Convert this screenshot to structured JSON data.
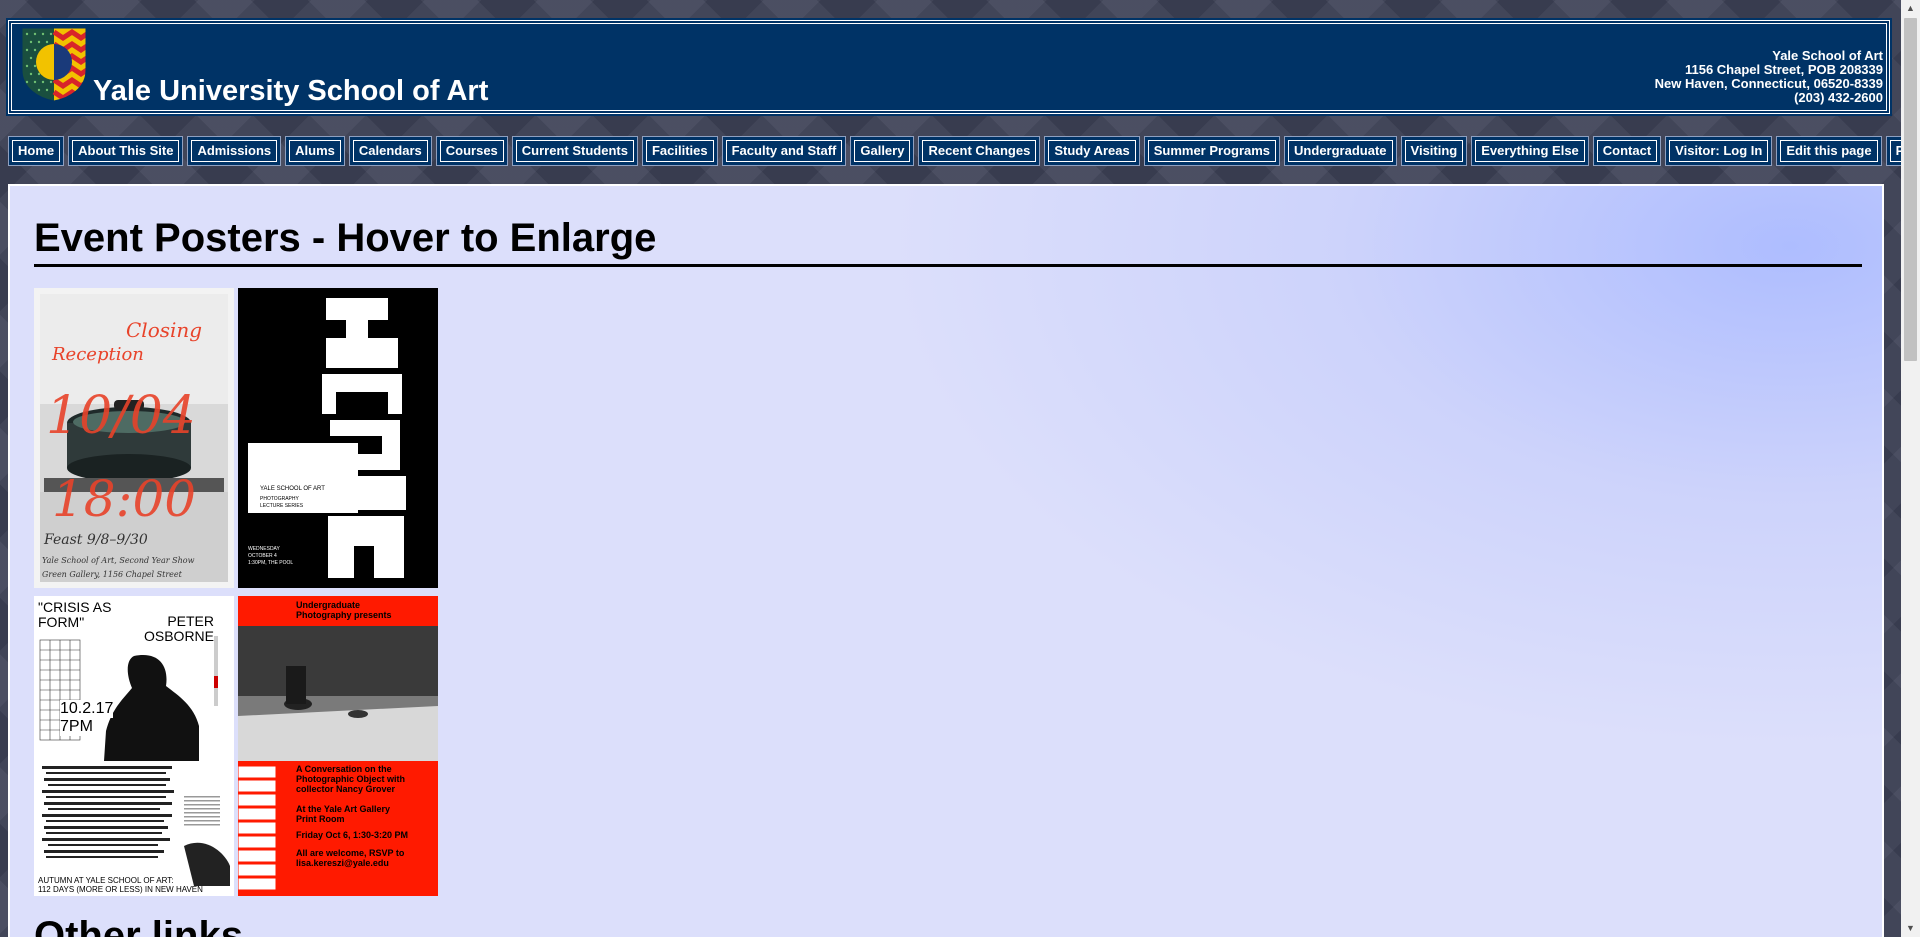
{
  "header": {
    "site_title": "Yale University School of Art",
    "address": {
      "name": "Yale School of Art",
      "street": "1156 Chapel Street, POB 208339",
      "city": "New Haven, Connecticut, 06520-8339",
      "phone": "(203) 432-2600"
    }
  },
  "nav": {
    "items": [
      {
        "label": "Home"
      },
      {
        "label": "About This Site"
      },
      {
        "label": "Admissions"
      },
      {
        "label": "Alums"
      },
      {
        "label": "Calendars"
      },
      {
        "label": "Courses"
      },
      {
        "label": "Current Students"
      },
      {
        "label": "Facilities"
      },
      {
        "label": "Faculty and Staff"
      },
      {
        "label": "Gallery"
      },
      {
        "label": "Recent Changes"
      },
      {
        "label": "Study Areas"
      },
      {
        "label": "Summer Programs"
      },
      {
        "label": "Undergraduate"
      },
      {
        "label": "Visiting"
      },
      {
        "label": "Everything Else"
      },
      {
        "label": "Contact"
      },
      {
        "label": "Visitor: Log In"
      },
      {
        "label": "Edit this page"
      },
      {
        "label": "Page history"
      }
    ]
  },
  "main": {
    "title": "Event Posters - Hover to Enlarge",
    "next_section_title": "Other links"
  },
  "posters": {
    "p1": {
      "word1": "Closing",
      "word2": "Reception",
      "date": "10/04",
      "time": "18:00",
      "line1": "Feast 9/8–9/30",
      "line2": "Yale School of Art, Second Year Show",
      "line3": "Green Gallery, 1156 Chapel Street"
    },
    "p2": {
      "org": "YALE SCHOOL OF ART",
      "series1": "PHOTOGRAPHY",
      "series2": "LECTURE SERIES",
      "speaker": "BILL ARNING",
      "day": "WEDNESDAY",
      "date": "OCTOBER 4",
      "time": "1:30PM, THE POOL"
    },
    "p3": {
      "title": "\"CRISIS AS FORM\"",
      "speaker": "PETER OSBORNE",
      "date": "10.2.17",
      "time": "7PM",
      "footer1": "AUTUMN AT YALE SCHOOL OF ART:",
      "footer2": "112 DAYS (MORE OR LESS) IN NEW HAVEN"
    },
    "p4": {
      "header": "Undergraduate Photography presents",
      "line1": "A Conversation on the Photographic Object with collector Nancy Grover",
      "line2": "At the Yale Art Gallery Print Room",
      "line3": "Friday Oct 6, 1:30-3:20 PM",
      "line4": "All are welcome, RSVP to lisa.kereszi@yale.edu"
    }
  },
  "colors": {
    "header_bg": "#003366",
    "poster_red": "#ff1a00",
    "script_red": "#e8432a"
  }
}
